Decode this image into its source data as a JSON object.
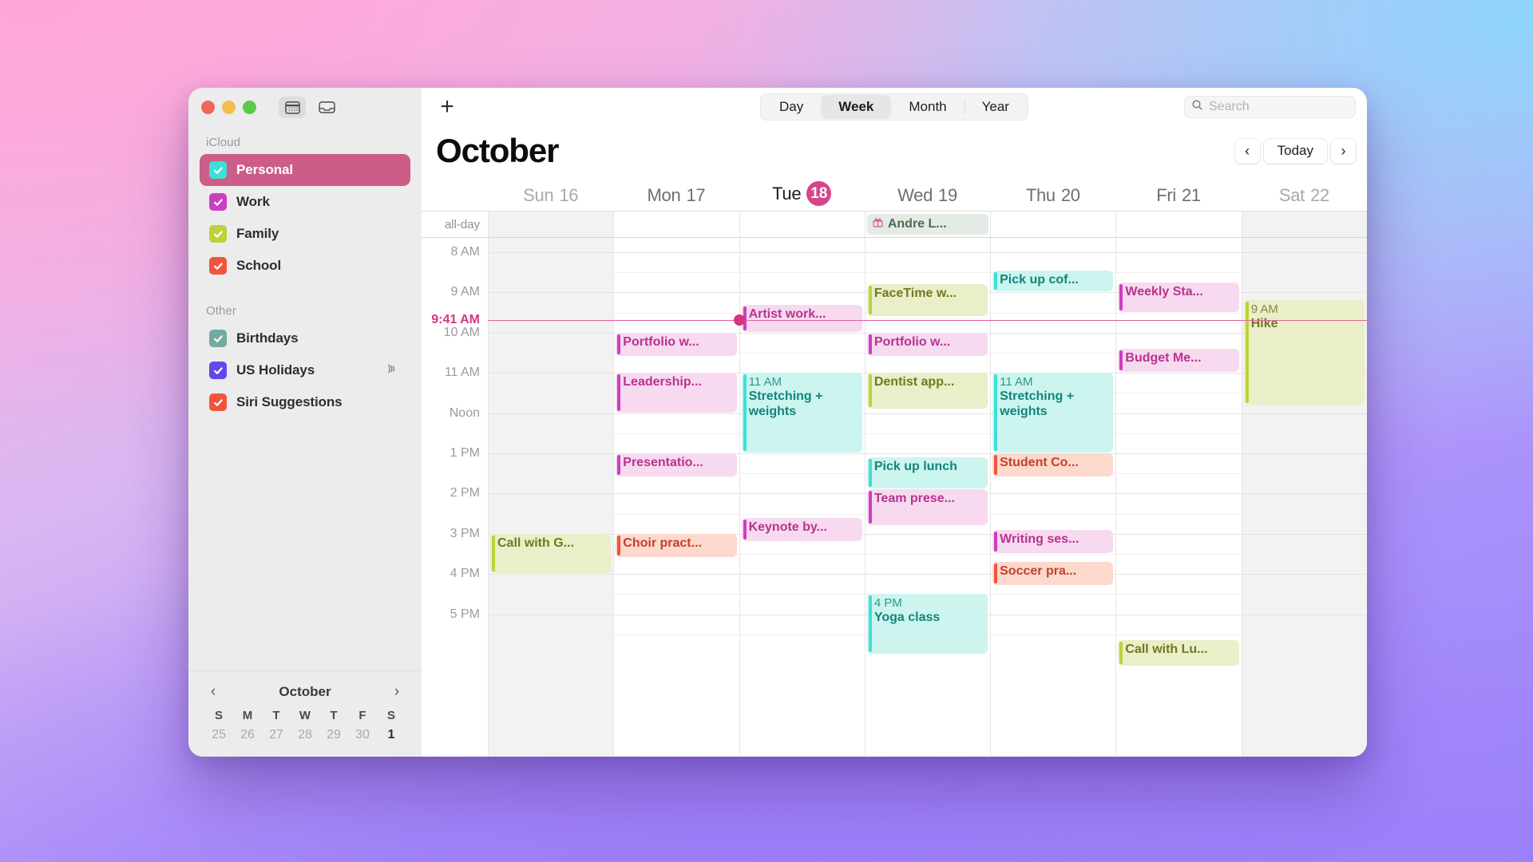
{
  "window": {
    "traffic": [
      "close",
      "minimize",
      "zoom"
    ],
    "toolbar_icons": [
      "calendar-view-icon",
      "inbox-icon"
    ]
  },
  "sidebar": {
    "groups": [
      {
        "title": "iCloud",
        "items": [
          {
            "label": "Personal",
            "color": "#3ce0d6",
            "selected": true,
            "checked": true,
            "broadcast": false
          },
          {
            "label": "Work",
            "color": "#cc3fc0",
            "selected": false,
            "checked": true,
            "broadcast": false
          },
          {
            "label": "Family",
            "color": "#bdd13a",
            "selected": false,
            "checked": true,
            "broadcast": false
          },
          {
            "label": "School",
            "color": "#f0553a",
            "selected": false,
            "checked": true,
            "broadcast": false
          }
        ]
      },
      {
        "title": "Other",
        "items": [
          {
            "label": "Birthdays",
            "color": "#74aaa0",
            "selected": false,
            "checked": true,
            "broadcast": false
          },
          {
            "label": "US Holidays",
            "color": "#6248e8",
            "selected": false,
            "checked": true,
            "broadcast": true
          },
          {
            "label": "Siri Suggestions",
            "color": "#f0553a",
            "selected": false,
            "checked": true,
            "broadcast": false
          }
        ]
      }
    ],
    "mini_calendar": {
      "title": "October",
      "prev": "‹",
      "next": "›",
      "dow": [
        "S",
        "M",
        "T",
        "W",
        "T",
        "F",
        "S"
      ],
      "days": [
        {
          "n": "25",
          "bold": false
        },
        {
          "n": "26",
          "bold": false
        },
        {
          "n": "27",
          "bold": false
        },
        {
          "n": "28",
          "bold": false
        },
        {
          "n": "29",
          "bold": false
        },
        {
          "n": "30",
          "bold": false
        },
        {
          "n": "1",
          "bold": true
        }
      ]
    }
  },
  "toolbar": {
    "add_label": "+",
    "views": [
      {
        "label": "Day",
        "active": false
      },
      {
        "label": "Week",
        "active": true
      },
      {
        "label": "Month",
        "active": false
      },
      {
        "label": "Year",
        "active": false
      }
    ],
    "search_placeholder": "Search"
  },
  "header": {
    "title": "October",
    "prev_label": "‹",
    "today_label": "Today",
    "next_label": "›"
  },
  "grid": {
    "allday_label": "all-day",
    "days": [
      {
        "name": "Sun",
        "num": "16",
        "weekend": true,
        "today": false
      },
      {
        "name": "Mon",
        "num": "17",
        "weekend": false,
        "today": false
      },
      {
        "name": "Tue",
        "num": "18",
        "weekend": false,
        "today": true
      },
      {
        "name": "Wed",
        "num": "19",
        "weekend": false,
        "today": false
      },
      {
        "name": "Thu",
        "num": "20",
        "weekend": false,
        "today": false
      },
      {
        "name": "Fri",
        "num": "21",
        "weekend": false,
        "today": false
      },
      {
        "name": "Sat",
        "num": "22",
        "weekend": true,
        "today": false
      }
    ],
    "hours": [
      "8 AM",
      "9 AM",
      "10 AM",
      "11 AM",
      "Noon",
      "1 PM",
      "2 PM",
      "3 PM",
      "4 PM",
      "5 PM"
    ],
    "current_time": "9:41 AM",
    "current_time_hour": 9.683,
    "allday_events": [
      {
        "day": 3,
        "title": "Andre L...",
        "icon": "gift-icon",
        "calendar": "Birthdays"
      }
    ],
    "events": [
      {
        "day": 1,
        "title": "Portfolio w...",
        "start": 10.0,
        "end": 10.6,
        "calendar": "Work",
        "bg": "#f7daef",
        "fg": "#b8338f",
        "bar": "#cc3fc0"
      },
      {
        "day": 1,
        "title": "Leadership...",
        "start": 11.0,
        "end": 12.0,
        "calendar": "Work",
        "bg": "#f7daef",
        "fg": "#b8338f",
        "bar": "#cc3fc0"
      },
      {
        "day": 1,
        "title": "Presentatio...",
        "start": 13.0,
        "end": 13.6,
        "calendar": "Work",
        "bg": "#f7daef",
        "fg": "#b8338f",
        "bar": "#cc3fc0"
      },
      {
        "day": 1,
        "title": "Choir pract...",
        "start": 15.0,
        "end": 15.6,
        "calendar": "School",
        "bg": "#fcd9cd",
        "fg": "#c2412a",
        "bar": "#f0553a"
      },
      {
        "day": 0,
        "title": "Call with G...",
        "start": 15.0,
        "end": 16.0,
        "calendar": "Family",
        "bg": "#eaeec9",
        "fg": "#6f7a1c",
        "bar": "#bdd13a"
      },
      {
        "day": 2,
        "title": "Artist work...",
        "start": 9.3,
        "end": 10.0,
        "calendar": "Work",
        "bg": "#f7daef",
        "fg": "#b8338f",
        "bar": "#cc3fc0"
      },
      {
        "day": 2,
        "title": "Stretching + weights",
        "time": "11 AM",
        "start": 11.0,
        "end": 13.0,
        "calendar": "Personal",
        "bg": "#ccf5ef",
        "fg": "#12857a",
        "bar": "#3ce0d6",
        "multiline": true
      },
      {
        "day": 2,
        "title": "Keynote by...",
        "start": 14.6,
        "end": 15.2,
        "calendar": "Work",
        "bg": "#f7daef",
        "fg": "#b8338f",
        "bar": "#cc3fc0"
      },
      {
        "day": 3,
        "title": "FaceTime w...",
        "start": 8.8,
        "end": 9.6,
        "calendar": "Family",
        "bg": "#eaeec9",
        "fg": "#6f7a1c",
        "bar": "#bdd13a"
      },
      {
        "day": 3,
        "title": "Portfolio w...",
        "start": 10.0,
        "end": 10.6,
        "calendar": "Work",
        "bg": "#f7daef",
        "fg": "#b8338f",
        "bar": "#cc3fc0"
      },
      {
        "day": 3,
        "title": "Dentist app...",
        "start": 11.0,
        "end": 11.9,
        "calendar": "Family",
        "bg": "#eaeec9",
        "fg": "#6f7a1c",
        "bar": "#bdd13a"
      },
      {
        "day": 3,
        "title": "Pick up lunch",
        "start": 13.1,
        "end": 13.9,
        "calendar": "Personal",
        "bg": "#ccf5ef",
        "fg": "#12857a",
        "bar": "#3ce0d6"
      },
      {
        "day": 3,
        "title": "Team prese...",
        "start": 13.9,
        "end": 14.8,
        "calendar": "Work",
        "bg": "#f7daef",
        "fg": "#b8338f",
        "bar": "#cc3fc0"
      },
      {
        "day": 3,
        "title": "Yoga class",
        "time": "4 PM",
        "start": 16.5,
        "end": 18.0,
        "calendar": "Personal",
        "bg": "#ccf5ef",
        "fg": "#12857a",
        "bar": "#3ce0d6",
        "multiline": true
      },
      {
        "day": 4,
        "title": "Pick up cof...",
        "start": 8.45,
        "end": 9.0,
        "calendar": "Personal",
        "bg": "#ccf5ef",
        "fg": "#12857a",
        "bar": "#3ce0d6"
      },
      {
        "day": 4,
        "title": "Stretching + weights",
        "time": "11 AM",
        "start": 11.0,
        "end": 13.0,
        "calendar": "Personal",
        "bg": "#ccf5ef",
        "fg": "#12857a",
        "bar": "#3ce0d6",
        "multiline": true
      },
      {
        "day": 4,
        "title": "Student Co...",
        "start": 13.0,
        "end": 13.6,
        "calendar": "School",
        "bg": "#fcd9cd",
        "fg": "#c2412a",
        "bar": "#f0553a"
      },
      {
        "day": 4,
        "title": "Writing ses...",
        "start": 14.9,
        "end": 15.5,
        "calendar": "Work",
        "bg": "#f7daef",
        "fg": "#b8338f",
        "bar": "#cc3fc0"
      },
      {
        "day": 4,
        "title": "Soccer pra...",
        "start": 15.7,
        "end": 16.3,
        "calendar": "School",
        "bg": "#fcd9cd",
        "fg": "#c2412a",
        "bar": "#f0553a"
      },
      {
        "day": 5,
        "title": "Weekly Sta...",
        "start": 8.75,
        "end": 9.5,
        "calendar": "Work",
        "bg": "#f7daef",
        "fg": "#b8338f",
        "bar": "#cc3fc0"
      },
      {
        "day": 5,
        "title": "Budget Me...",
        "start": 10.4,
        "end": 11.0,
        "calendar": "Work",
        "bg": "#f7daef",
        "fg": "#b8338f",
        "bar": "#cc3fc0"
      },
      {
        "day": 5,
        "title": "Call with Lu...",
        "start": 17.65,
        "end": 18.3,
        "calendar": "Family",
        "bg": "#eaeec9",
        "fg": "#6f7a1c",
        "bar": "#bdd13a"
      },
      {
        "day": 6,
        "title": "Hike",
        "time": "9 AM",
        "start": 9.2,
        "end": 11.8,
        "calendar": "Family",
        "bg": "#eaeec9",
        "fg": "#6f7a1c",
        "bar": "#bdd13a",
        "multiline": true
      }
    ]
  }
}
